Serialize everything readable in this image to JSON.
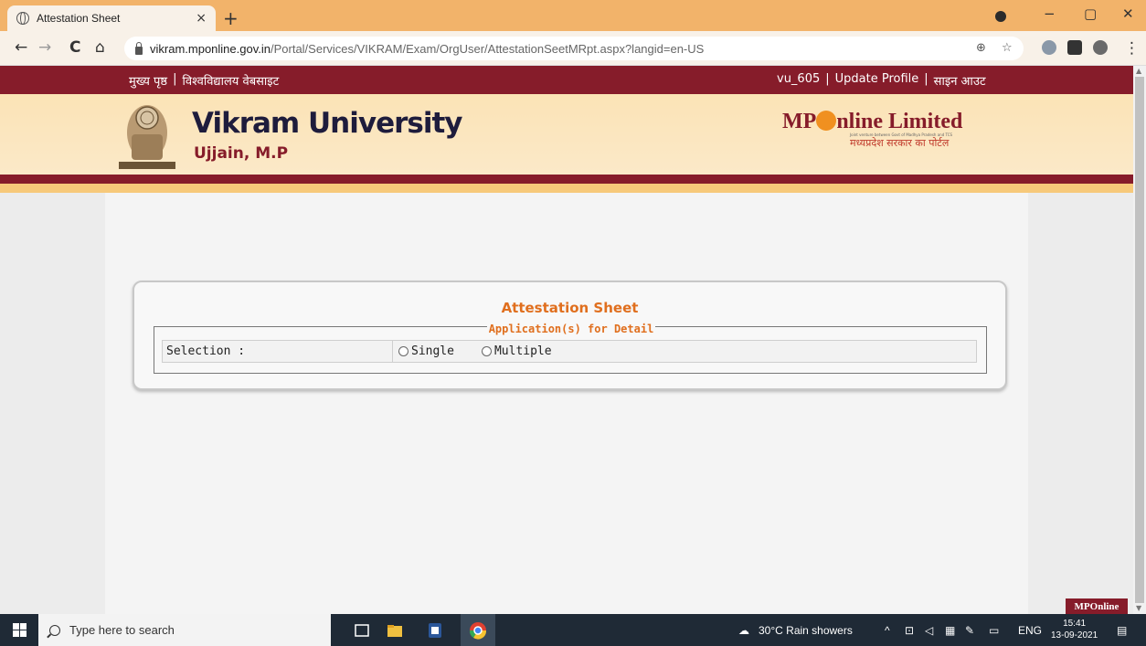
{
  "browser": {
    "tab_title": "Attestation Sheet",
    "tab_close": "×",
    "new_tab": "+",
    "url_host": "vikram.mponline.gov.in",
    "url_path": "/Portal/Services/VIKRAM/Exam/OrgUser/AttestationSeetMRpt.aspx?langid=en-US",
    "nav": {
      "back": "←",
      "forward": "→",
      "reload": "C",
      "home": "⌂"
    },
    "window": {
      "minimize": "−",
      "restore": "▢",
      "close": "✕"
    },
    "omni_icons": {
      "zoom": "⊕",
      "star": "☆"
    },
    "menu": "⋮"
  },
  "topnav": {
    "home": "मुख्य पृष्ठ",
    "sep": "|",
    "university_site": "विश्वविद्यालय वेबसाइट",
    "user": "vu_605",
    "update_profile": "Update Profile",
    "logout": "साइन आउट"
  },
  "banner": {
    "university_name": "Vikram University",
    "city": "Ujjain, M.P",
    "mp_logo_left": "MP",
    "mp_logo_right": "nline Limited",
    "mp_tagline": "Joint venture between Govt of Madhya Pradesh and TCS",
    "mp_hindi": "मध्यप्रदेश सरकार का पोर्टल"
  },
  "card": {
    "title": "Attestation Sheet",
    "legend": "Application(s) for Detail",
    "selection_label": "Selection :",
    "options": [
      "Single",
      "Multiple"
    ]
  },
  "badge": "MPOnline",
  "taskbar": {
    "search_placeholder": "Type here to search",
    "weather": "30°C  Rain showers",
    "lang": "ENG",
    "time": "15:41",
    "date": "13-09-2021",
    "tray_up": "^"
  },
  "colors": {
    "maroon": "#861c2a",
    "orange": "#e06f1e",
    "tab_strip": "#f2b36a",
    "taskbar": "#1f2a36"
  }
}
